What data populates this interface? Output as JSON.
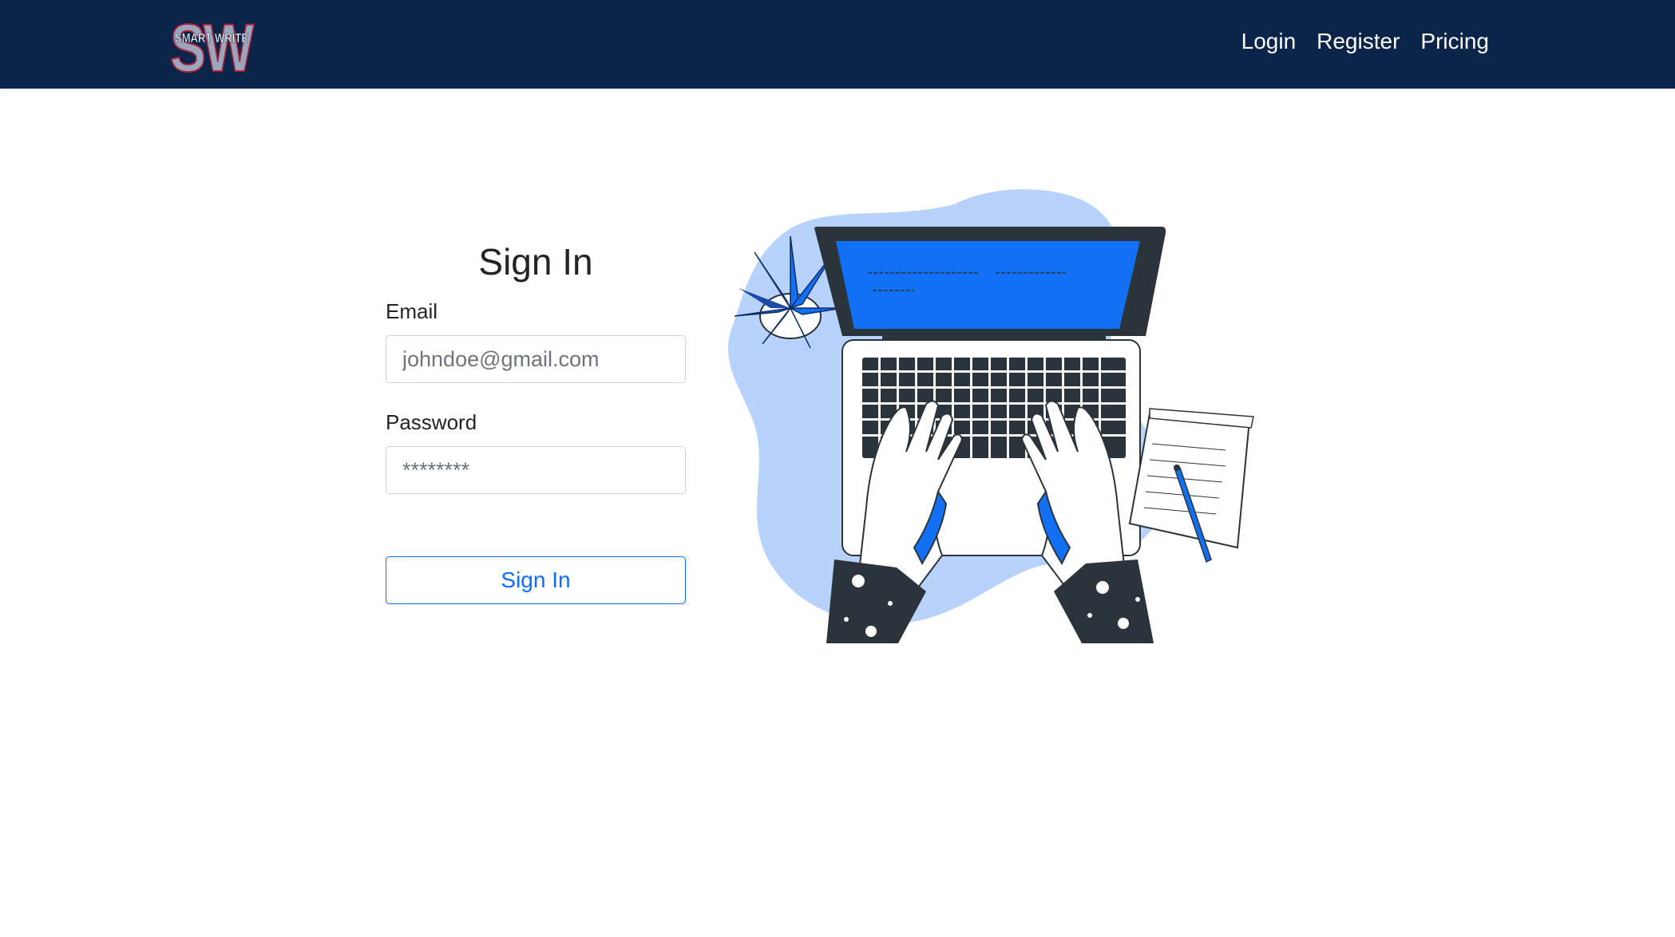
{
  "brand": {
    "logo_initials": "SW",
    "logo_caption": "SMART WRITE"
  },
  "nav": {
    "links": [
      "Login",
      "Register",
      "Pricing"
    ]
  },
  "form": {
    "title": "Sign In",
    "email_label": "Email",
    "email_placeholder": "johndoe@gmail.com",
    "password_label": "Password",
    "password_placeholder": "********",
    "submit_label": "Sign In"
  },
  "colors": {
    "navbar": "#0b244a",
    "accent": "#0d6efd",
    "illustration_blue": "#1270f5",
    "blob": "#b7d3fb"
  },
  "icons": {
    "illustration": "laptop-typing-illustration"
  }
}
